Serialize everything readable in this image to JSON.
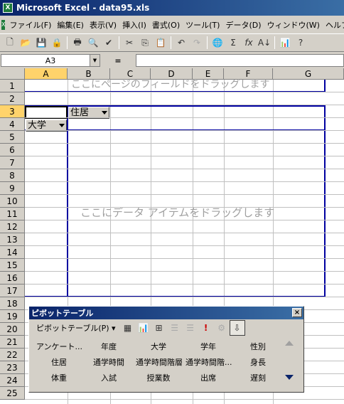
{
  "window": {
    "title": "Microsoft Excel - data95.xls"
  },
  "menu": {
    "items": [
      "ファイル(F)",
      "編集(E)",
      "表示(V)",
      "挿入(I)",
      "書式(O)",
      "ツール(T)",
      "データ(D)",
      "ウィンドウ(W)",
      "ヘルプ"
    ]
  },
  "toolbar": {
    "icons": [
      "new-file",
      "open",
      "save",
      "permission",
      "print",
      "print-preview",
      "spelling",
      "cut",
      "copy",
      "paste",
      "undo",
      "redo",
      "hyperlink",
      "autosum",
      "function",
      "sort-ascending",
      "chart",
      "help"
    ],
    "sigma": "Σ",
    "fx": "fx",
    "zoom_glyph": "?"
  },
  "formula_bar": {
    "name_box": "A3",
    "equals": "=",
    "value": ""
  },
  "columns": [
    "A",
    "B",
    "C",
    "D",
    "E",
    "F",
    "G"
  ],
  "rows": [
    "1",
    "2",
    "3",
    "4",
    "5",
    "6",
    "7",
    "8",
    "9",
    "10",
    "11",
    "12",
    "13",
    "14",
    "15",
    "16",
    "17",
    "18",
    "19",
    "20",
    "21",
    "22",
    "23",
    "24",
    "25"
  ],
  "pivot": {
    "page_hint": "ここにページのフィールドをドラッグします",
    "data_hint": "ここにデータ アイテムをドラッグします",
    "column_field": "住居",
    "row_field": "大学"
  },
  "pivot_toolbar": {
    "title": "ピボットテーブル",
    "close": "×",
    "menu_label": "ピボットテーブル(P) ▾",
    "fields": [
      [
        "アンケート...",
        "年度",
        "大学",
        "学年",
        "性別"
      ],
      [
        "住居",
        "通学時間",
        "通学時間階層",
        "通学時間階...",
        "身長"
      ],
      [
        "体重",
        "入試",
        "授業数",
        "出席",
        "遅刻"
      ]
    ]
  }
}
